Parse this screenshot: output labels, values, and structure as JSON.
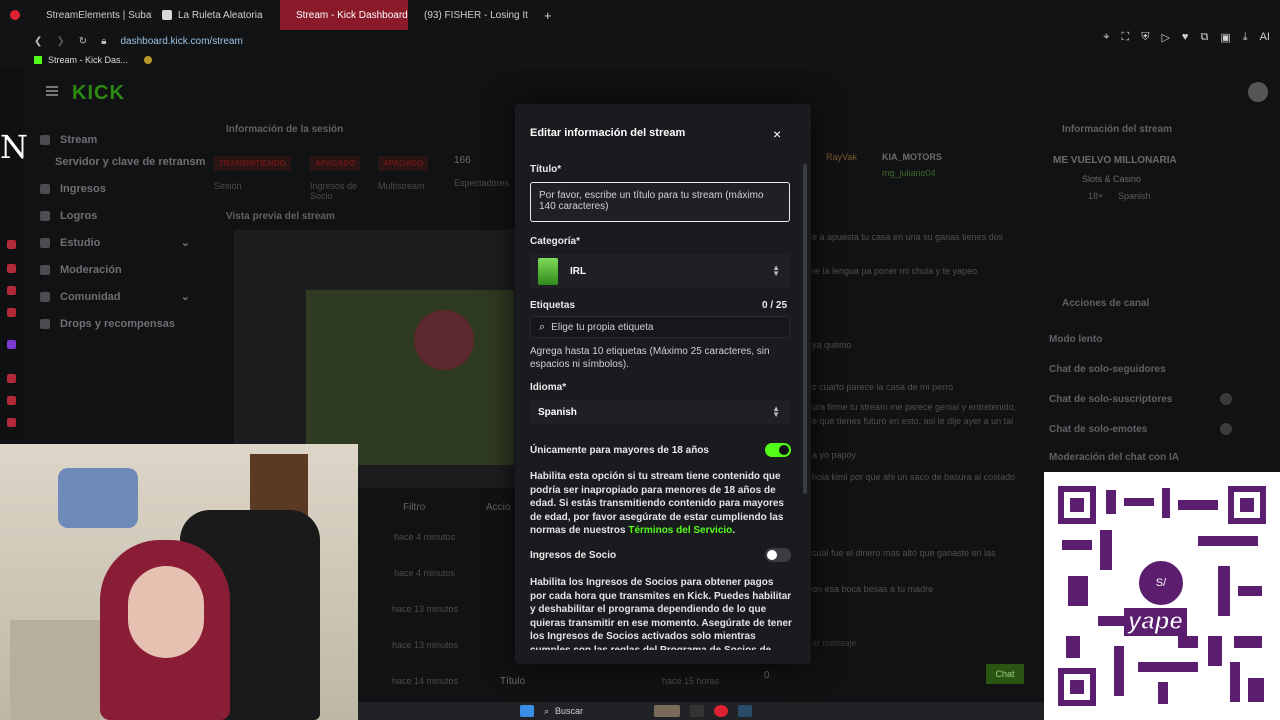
{
  "browser": {
    "tabs": [
      {
        "label": "StreamElements | Subatho",
        "color": "#4c7cf0",
        "active": false
      },
      {
        "label": "La Ruleta Aleatoria",
        "color": "#d9d9d9",
        "active": false
      },
      {
        "label": "Stream - Kick Dashboard",
        "color": "#53fc18",
        "active": true
      },
      {
        "label": "(93) FISHER - Losing It",
        "color": "#ff2a2a",
        "active": false
      }
    ],
    "new_tab": "+",
    "url": "dashboard.kick.com/stream",
    "bookmark": "Stream - Kick Das...",
    "ai_label": "AI"
  },
  "overlay": {
    "letter": "N"
  },
  "dashboard": {
    "logo": "KICK",
    "nav": [
      {
        "label": "Stream",
        "expand": ""
      },
      {
        "label": "Ingresos",
        "expand": ""
      },
      {
        "label": "Logros",
        "expand": ""
      },
      {
        "label": "Estudio",
        "expand": "⌄"
      },
      {
        "label": "Moderación",
        "expand": ""
      },
      {
        "label": "Comunidad",
        "expand": "⌄"
      },
      {
        "label": "Drops y recompensas",
        "expand": ""
      }
    ],
    "server_key": "Servidor y clave de retransm",
    "session_title": "Información de la sesión",
    "badges": [
      "TRANSMITIENDO",
      "APAGADO",
      "APAGADO"
    ],
    "count": "166",
    "badge_labels": [
      "Sesión",
      "Ingresos de Socio",
      "Multistream",
      "Espectadores"
    ],
    "preview_title": "Vista previa del stream",
    "filter_label": "Filtro",
    "actions_label": "Accio",
    "time_rows": [
      "hace 4 minutos",
      "hace 4 minutos",
      "hace 13 minutos",
      "hace 13 minutos",
      "hace 14 minutos"
    ],
    "titulo_row": "Título",
    "titulo_time": "hace 15 horas",
    "zero": "0"
  },
  "chat": {
    "users": [
      "RayVak",
      "KIA_MOTORS",
      "mg_juliario04"
    ],
    "messages": [
      "e a apuesta tu casa en una su ganas tienes dos",
      "re la lengua pa poner mi chula y te yapeo",
      "ya quemo",
      "c cuarto parece la casa de mi perro",
      "ura firme tu stream me parece genial y entretenido,",
      "e que tienes futuro en esto, asi le dije ayer a un tal",
      "a yo papoy",
      "hola kiml por que ahi un saco de basura al costado",
      "cual fue el dinero mas alto que ganaste en las",
      "on esa boca besas a tu madre"
    ],
    "input_placeholder": "ar mensaje",
    "send": "Chat"
  },
  "stream_info": {
    "header": "Información del stream",
    "title": "ME VUELVO MILLONARIA",
    "category": "Slots & Casino",
    "tags": [
      "18+",
      "Spanish"
    ],
    "channel_actions": "Acciones de canal",
    "actions": [
      "Modo lento",
      "Chat de solo-seguidores",
      "Chat de solo-suscriptores",
      "Chat de solo-emotes",
      "Moderación del chat con IA"
    ]
  },
  "modal": {
    "title": "Editar información del stream",
    "close": "×",
    "title_label": "Título*",
    "title_placeholder": "Por favor, escribe un título para tu stream (máximo 140 caracteres)",
    "category_label": "Categoría*",
    "category_value": "IRL",
    "tags_label": "Etiquetas",
    "tags_count": "0 / 25",
    "tags_placeholder": "Elige tu propia etiqueta",
    "tags_hint": "Agrega hasta 10 etiquetas (Máximo 25 caracteres, sin espacios ni símbolos).",
    "language_label": "Idioma*",
    "language_value": "Spanish",
    "mature_label": "Únicamente para mayores de 18 años",
    "mature_on": true,
    "mature_text": "Habilita esta opción si tu stream tiene contenido que podría ser inapropiado para menores de 18 años de edad. Si estás transmitiendo contenido para mayores de edad, por favor asegúrate de estar cumpliendo las normas de nuestros ",
    "mature_link": "Términos del Servicio",
    "mature_end": ".",
    "partner_label": "Ingresos de Socio",
    "partner_on": false,
    "partner_text": "Habilita los Ingresos de Socios para obtener pagos por cada hora que transmites en Kick. Puedes habilitar y deshabilitar el programa dependiendo de lo que quieras transmitir en ese momento. Asegúrate de tener los Ingresos de Socios activados solo mientras cumples con las reglas del Programa de Socios de Kick."
  },
  "qr": {
    "brand": "yape",
    "badge": "S/"
  },
  "taskbar": {
    "search": "Buscar"
  },
  "colors": {
    "kick_green": "#53fc18",
    "yape_purple": "#5b1e6e",
    "live_red": "#8a1a2a"
  }
}
